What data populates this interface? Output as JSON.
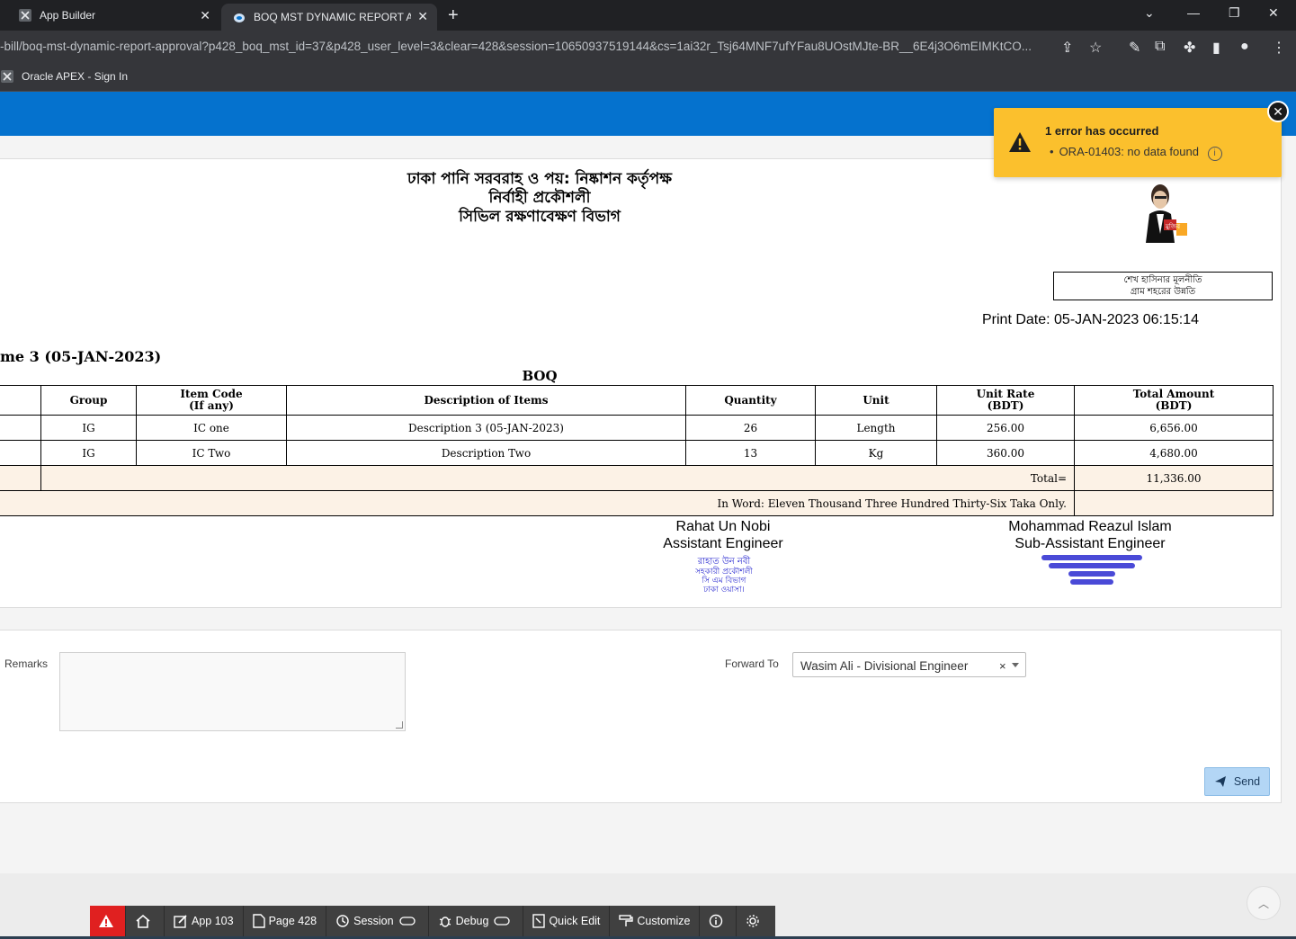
{
  "browser": {
    "tabs": [
      {
        "title": "App Builder"
      },
      {
        "title": "BOQ MST DYNAMIC REPORT APPR"
      }
    ],
    "url": "-bill/boq-mst-dynamic-report-approval?p428_boq_mst_id=37&p428_user_level=3&clear=428&session=10650937519144&cs=1ai32r_Tsj64MNF7ufYFau8UOstMJte-BR__6E4j3O6mEIMKtCO...",
    "bookmark": "Oracle APEX - Sign In"
  },
  "report": {
    "header_line1": "ঢাকা পানি সরবরাহ ও পয়: নিষ্কাশন কর্তৃপক্ষ",
    "header_line2": "নির্বাহী প্রকৌশলী",
    "header_line3": "সিভিল রক্ষণাবেক্ষণ বিভাগ",
    "motto_line1": "শেখ হাসিনার মূলনীতি",
    "motto_line2": "গ্রাম শহরের উন্নতি",
    "print_date": "Print Date: 05-JAN-2023 06:15:14",
    "scheme_title": "me 3 (05-JAN-2023)",
    "boq_caption": "BOQ",
    "columns": [
      {
        "l1": "Group",
        "l2": ""
      },
      {
        "l1": "Item Code",
        "l2": "(If any)"
      },
      {
        "l1": "Description of Items",
        "l2": ""
      },
      {
        "l1": "Quantity",
        "l2": ""
      },
      {
        "l1": "Unit",
        "l2": ""
      },
      {
        "l1": "Unit Rate",
        "l2": "(BDT)"
      },
      {
        "l1": "Total Amount",
        "l2": "(BDT)"
      }
    ],
    "rows": [
      {
        "group": "IG",
        "item_code": "IC one",
        "description": "Description 3 (05-JAN-2023)",
        "quantity": "26",
        "unit": "Length",
        "unit_rate": "256.00",
        "total": "6,656.00"
      },
      {
        "group": "IG",
        "item_code": "IC Two",
        "description": "Description Two",
        "quantity": "13",
        "unit": "Kg",
        "unit_rate": "360.00",
        "total": "4,680.00"
      }
    ],
    "total_label": "Total=",
    "total_value": "11,336.00",
    "in_word": "In Word: Eleven Thousand Three Hundred Thirty-Six Taka Only.",
    "signatories": [
      {
        "name": "Rahat Un Nobi",
        "designation": "Assistant Engineer"
      },
      {
        "name": "Mohammad Reazul Islam",
        "designation": "Sub-Assistant Engineer"
      }
    ]
  },
  "form": {
    "remarks_label": "Remarks",
    "remarks_value": "",
    "forward_label": "Forward To",
    "forward_value": "Wasim Ali - Divisional Engineer",
    "send_label": "Send"
  },
  "error": {
    "title": "1 error has occurred",
    "message": "ORA-01403: no data found"
  },
  "devbar": {
    "app": "App 103",
    "page": "Page 428",
    "session": "Session",
    "debug": "Debug",
    "quick_edit": "Quick Edit",
    "customize": "Customize"
  },
  "colors": {
    "header_blue": "#0572ce",
    "error_yellow": "#fbc02d",
    "total_row_beige": "#fcf2e6",
    "send_button": "#b3d6f5",
    "devbar_alert": "#e02020"
  }
}
